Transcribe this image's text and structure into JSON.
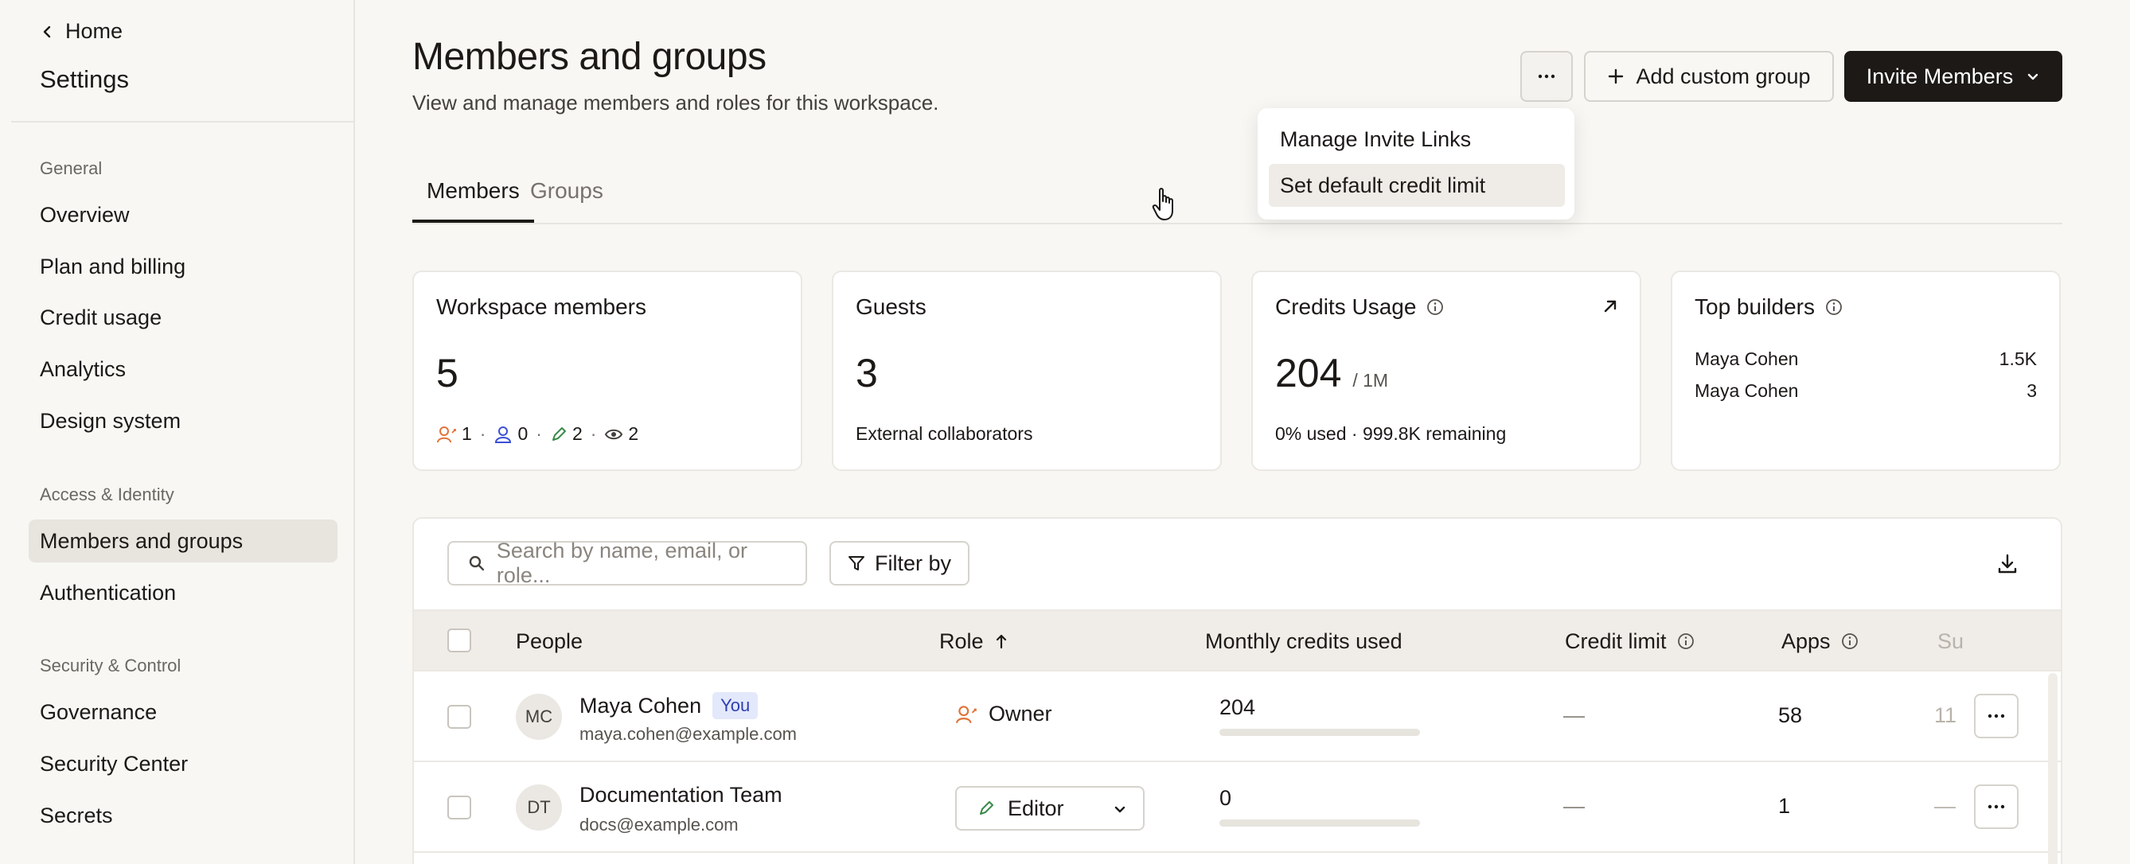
{
  "sidebar": {
    "home_label": "Home",
    "title": "Settings",
    "sections": {
      "general": "General",
      "access": "Access & Identity",
      "security": "Security & Control"
    },
    "items": {
      "overview": "Overview",
      "plan": "Plan and billing",
      "credit": "Credit usage",
      "analytics": "Analytics",
      "design": "Design system",
      "members": "Members and groups",
      "auth": "Authentication",
      "governance": "Governance",
      "security_center": "Security Center",
      "secrets": "Secrets"
    },
    "active_item": "Members and groups"
  },
  "header": {
    "title": "Members and groups",
    "subtitle": "View and manage members and roles for this workspace.",
    "more_label": "···",
    "add_group_label": "Add custom group",
    "invite_label": "Invite Members"
  },
  "menu": {
    "items": [
      "Manage Invite Links",
      "Set default credit limit"
    ],
    "hovered": "Set default credit limit"
  },
  "tabs": {
    "members": "Members",
    "groups": "Groups",
    "active": "Members"
  },
  "cards": {
    "workspace": {
      "title": "Workspace members",
      "value": "5",
      "owners": "1",
      "admins": "0",
      "editors": "2",
      "viewers": "2",
      "sep": "·"
    },
    "guests": {
      "title": "Guests",
      "value": "3",
      "foot": "External collaborators"
    },
    "credits": {
      "title": "Credits Usage",
      "value": "204",
      "suffix": "/ 1M",
      "foot": "0% used · 999.8K remaining"
    },
    "builders": {
      "title": "Top builders",
      "rows": [
        {
          "name": "Maya Cohen",
          "value": "1.5K"
        },
        {
          "name": "Maya Cohen",
          "value": "3"
        }
      ]
    }
  },
  "table": {
    "search_placeholder": "Search by name, email, or role...",
    "filter_label": "Filter by",
    "columns": {
      "people": "People",
      "role": "Role",
      "credits": "Monthly credits used",
      "limit": "Credit limit",
      "apps": "Apps",
      "cut": "Su"
    },
    "rows": [
      {
        "initials": "MC",
        "name": "Maya Cohen",
        "badge": "You",
        "email": "maya.cohen@example.com",
        "role": "Owner",
        "credits": "204",
        "credits_fraction": 0.0,
        "limit": "—",
        "apps": "58",
        "cut": "11"
      },
      {
        "initials": "DT",
        "name": "Documentation Team",
        "email": "docs@example.com",
        "role": "Editor",
        "credits": "0",
        "credits_fraction": 0.0,
        "limit": "—",
        "apps": "1",
        "cut": "—"
      }
    ]
  },
  "colors": {
    "owner": "#e0733a",
    "admin": "#3b50d6",
    "editor": "#3a8a4a",
    "viewer": "#44403c",
    "primary": "#1c1917"
  }
}
